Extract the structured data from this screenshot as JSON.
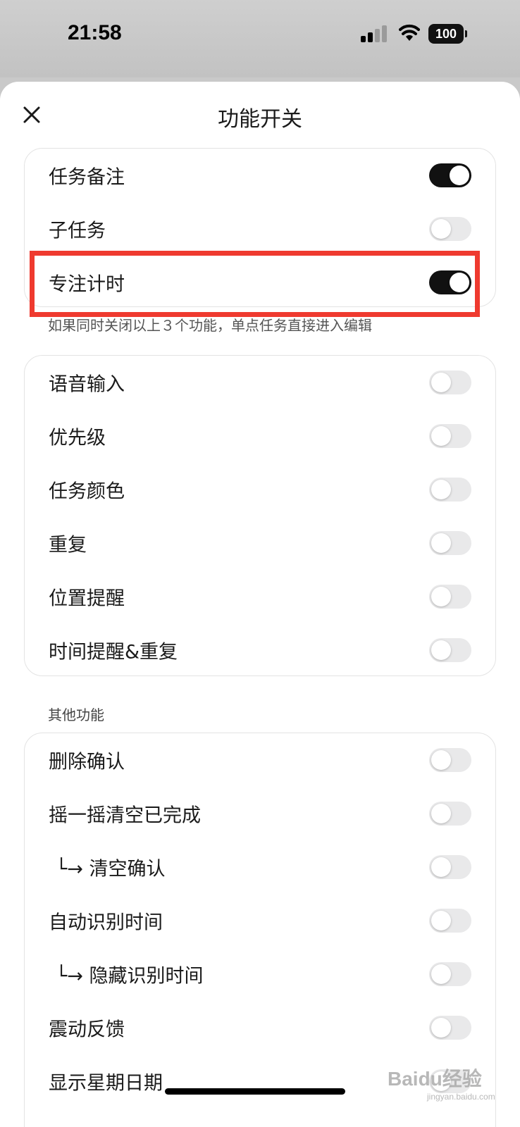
{
  "status_bar": {
    "time": "21:58",
    "battery": "100"
  },
  "header": {
    "title": "功能开关"
  },
  "group1": {
    "items": [
      {
        "label": "任务备注",
        "on": true
      },
      {
        "label": "子任务",
        "on": false
      },
      {
        "label": "专注计时",
        "on": true
      }
    ],
    "note": "如果同时关闭以上３个功能，单点任务直接进入编辑"
  },
  "group2": {
    "items": [
      {
        "label": "语音输入",
        "on": false
      },
      {
        "label": "优先级",
        "on": false
      },
      {
        "label": "任务颜色",
        "on": false
      },
      {
        "label": "重复",
        "on": false
      },
      {
        "label": "位置提醒",
        "on": false
      },
      {
        "label": "时间提醒&重复",
        "on": false
      }
    ]
  },
  "group3": {
    "section_label": "其他功能",
    "items": [
      {
        "label": "删除确认",
        "on": false
      },
      {
        "label": "摇一摇清空已完成",
        "on": false
      },
      {
        "label": "└→ 清空确认",
        "on": false
      },
      {
        "label": "自动识别时间",
        "on": false
      },
      {
        "label": "└→ 隐藏识别时间",
        "on": false
      },
      {
        "label": "震动反馈",
        "on": false
      },
      {
        "label": "显示星期日期",
        "on": false
      }
    ]
  },
  "watermark": {
    "text": "Baidu经验",
    "sub": "jingyan.baidu.com"
  },
  "colors": {
    "toggle_on": "#111111",
    "toggle_off": "#e9e9ea",
    "highlight": "#ef3a2f"
  }
}
